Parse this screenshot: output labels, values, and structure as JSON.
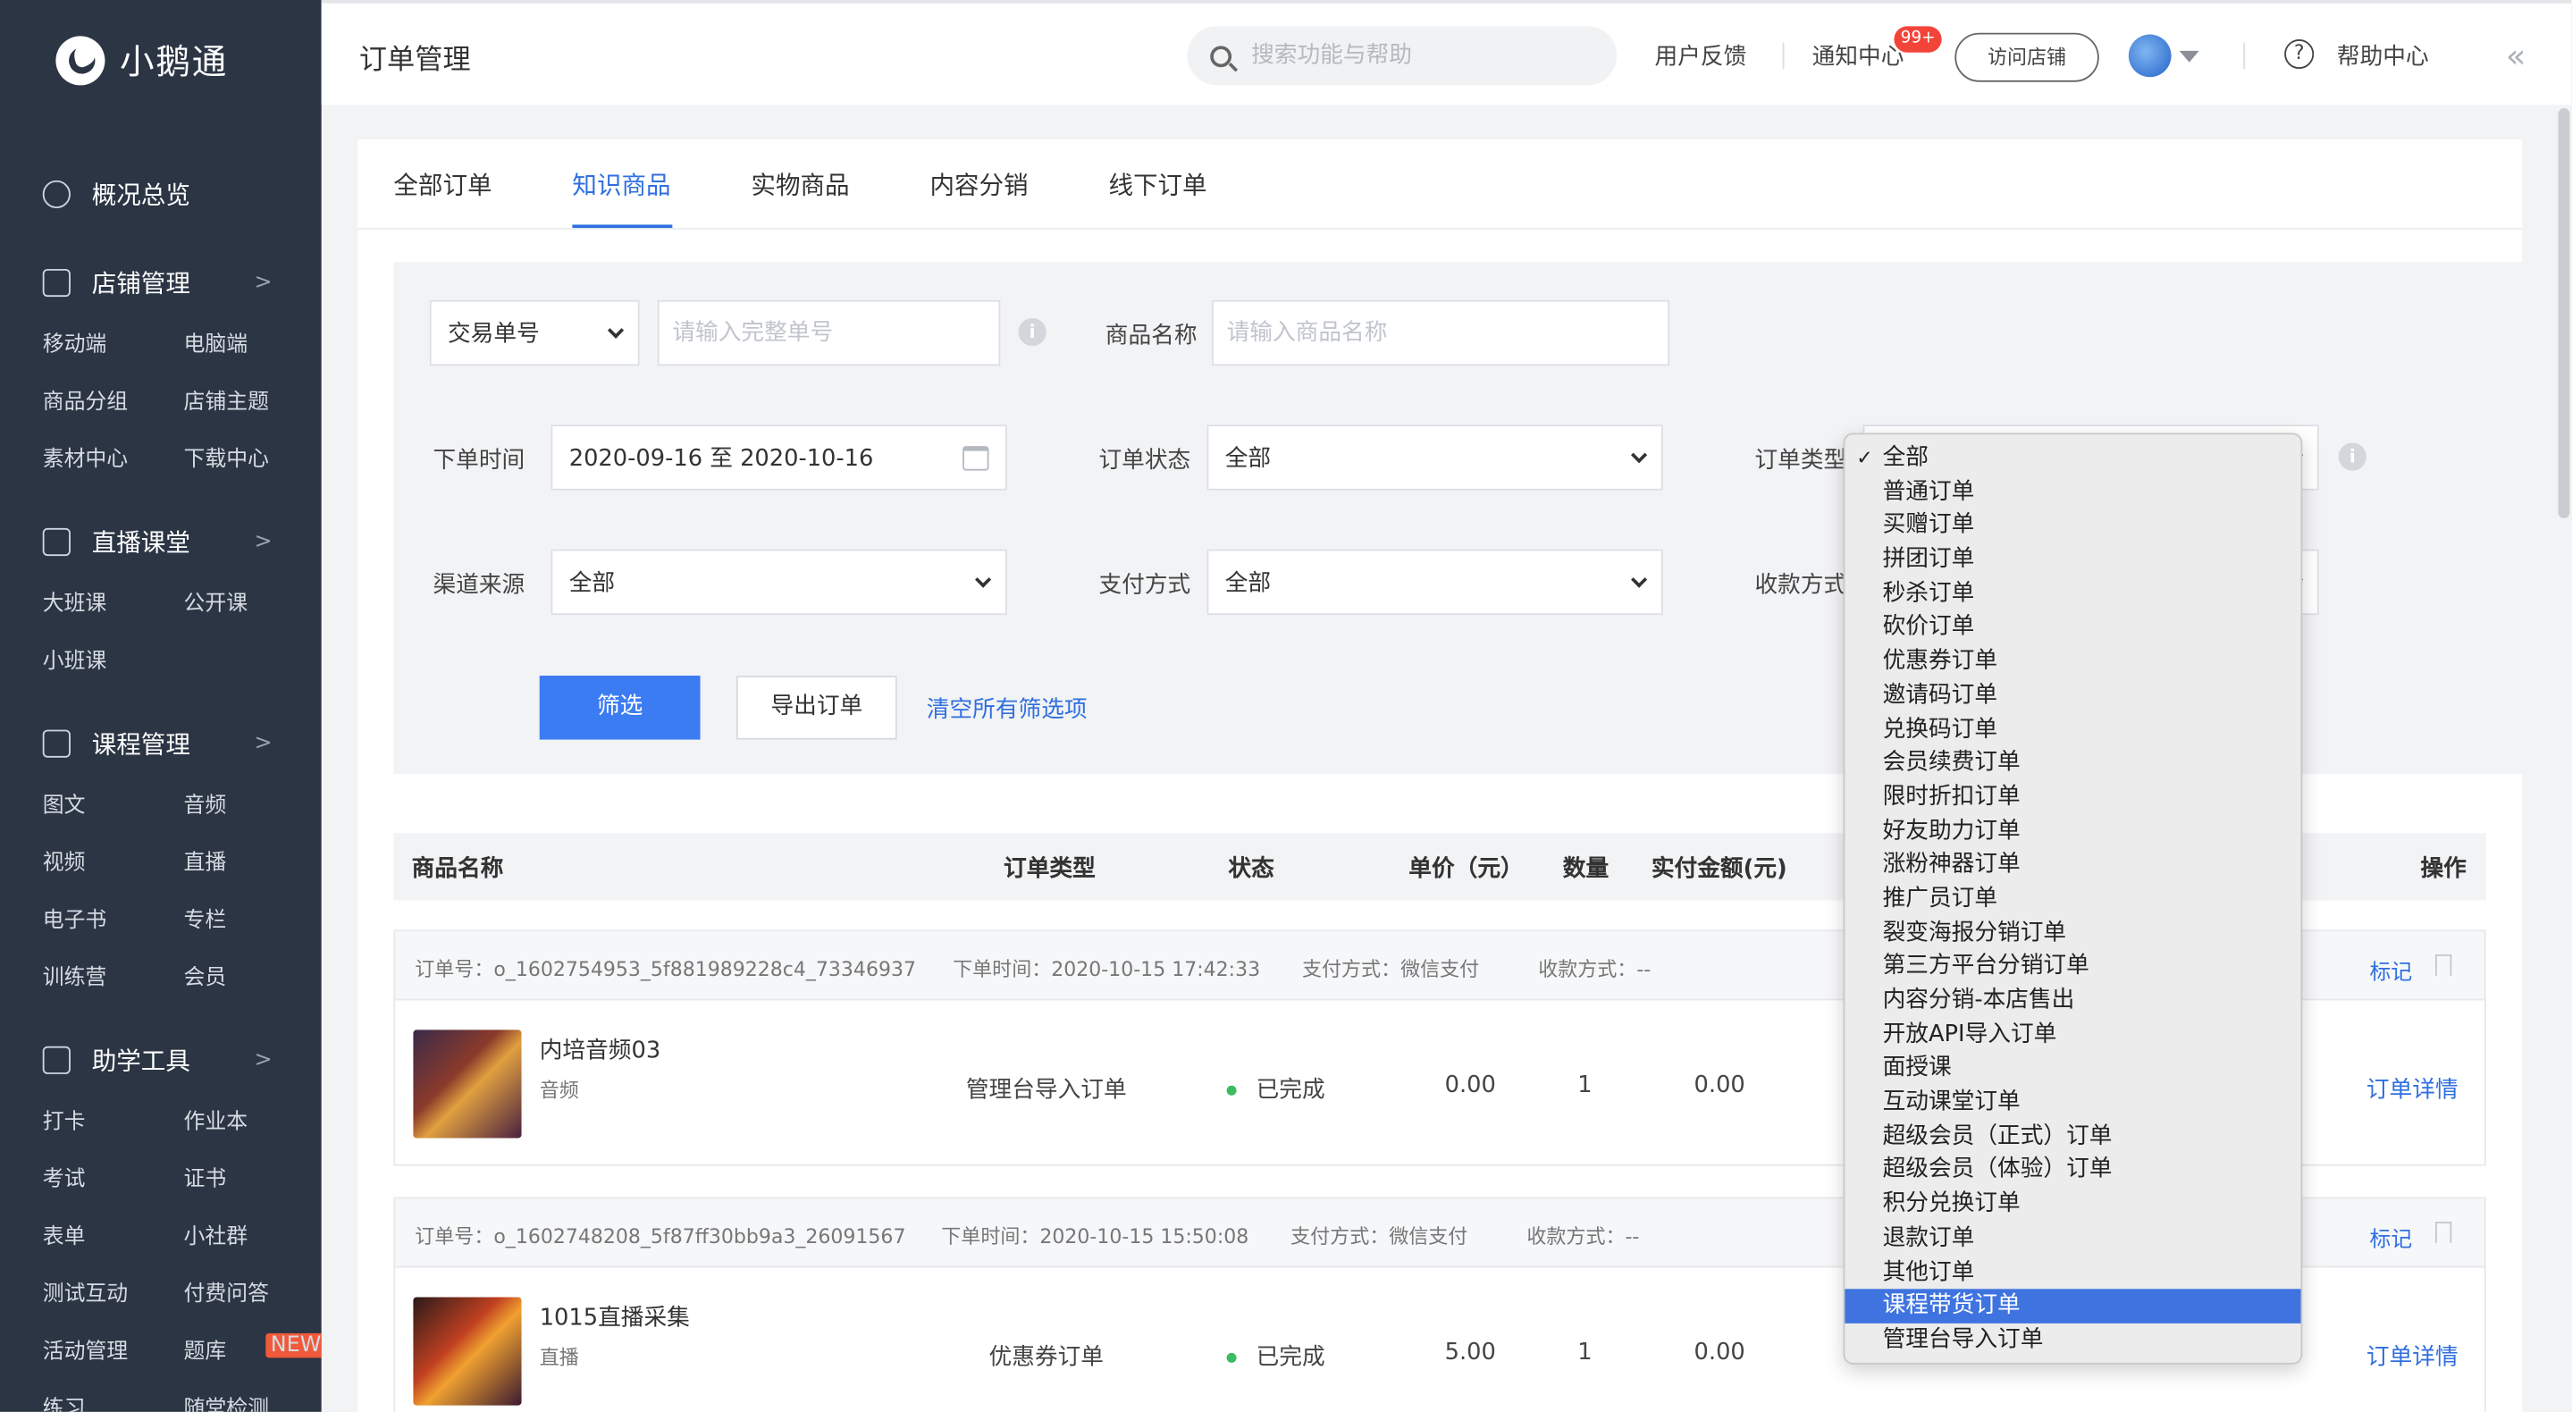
{
  "app": {
    "name": "小鹅通"
  },
  "sidebar": {
    "overview": "概况总览",
    "groups": [
      {
        "title": "店铺管理",
        "items": [
          "移动端",
          "电脑端",
          "商品分组",
          "店铺主题",
          "素材中心",
          "下载中心"
        ]
      },
      {
        "title": "直播课堂",
        "items": [
          "大班课",
          "公开课",
          "小班课"
        ]
      },
      {
        "title": "课程管理",
        "items": [
          "图文",
          "音频",
          "视频",
          "直播",
          "电子书",
          "专栏",
          "训练营",
          "会员"
        ]
      },
      {
        "title": "助学工具",
        "items": [
          "打卡",
          "作业本",
          "考试",
          "证书",
          "表单",
          "小社群",
          "测试互动",
          "付费问答",
          "活动管理",
          "题库",
          "练习",
          "随堂检测"
        ]
      }
    ],
    "new_badge": "NEW"
  },
  "topbar": {
    "page_title": "订单管理",
    "search_placeholder": "搜索功能与帮助",
    "feedback": "用户反馈",
    "notifications": "通知中心",
    "notification_count": "99+",
    "visit_store": "访问店铺",
    "help": "帮助中心"
  },
  "tabs": [
    "全部订单",
    "知识商品",
    "实物商品",
    "内容分销",
    "线下订单"
  ],
  "active_tab": "知识商品",
  "filters": {
    "order_no_select": "交易单号",
    "order_no_placeholder": "请输入完整单号",
    "product_label": "商品名称",
    "product_placeholder": "请输入商品名称",
    "order_time_label": "下单时间",
    "order_time_value": "2020-09-16 至 2020-10-16",
    "order_status_label": "订单状态",
    "order_status_value": "全部",
    "order_type_label": "订单类型",
    "channel_label": "渠道来源",
    "channel_value": "全部",
    "pay_method_label": "支付方式",
    "pay_method_value": "全部",
    "collect_label": "收款方式",
    "filter_button": "筛选",
    "export_button": "导出订单",
    "clear_link": "清空所有筛选项"
  },
  "table": {
    "headers": [
      "商品名称",
      "订单类型",
      "状态",
      "单价（元）",
      "数量",
      "实付金额(元)",
      "操作"
    ],
    "orders": [
      {
        "order_no": "订单号：o_1602754953_5f881989228c4_73346937",
        "order_time": "下单时间：2020-10-15 17:42:33",
        "pay_method": "支付方式：微信支付",
        "collect": "收款方式：--",
        "mark": "标记",
        "product": "内培音频03",
        "product_type": "音频",
        "order_type": "管理台导入订单",
        "status": "已完成",
        "price": "0.00",
        "qty": "1",
        "paid": "0.00",
        "action": "订单详情"
      },
      {
        "order_no": "订单号：o_1602748208_5f87ff30bb9a3_26091567",
        "order_time": "下单时间：2020-10-15 15:50:08",
        "pay_method": "支付方式：微信支付",
        "collect": "收款方式：--",
        "mark": "标记",
        "product": "1015直播采集",
        "product_type": "直播",
        "order_type": "优惠券订单",
        "status": "已完成",
        "price": "5.00",
        "qty": "1",
        "paid": "0.00",
        "action": "订单详情"
      }
    ]
  },
  "order_type_dropdown": {
    "checked": "全部",
    "highlighted": "课程带货订单",
    "options": [
      "全部",
      "普通订单",
      "买赠订单",
      "拼团订单",
      "秒杀订单",
      "砍价订单",
      "优惠券订单",
      "邀请码订单",
      "兑换码订单",
      "会员续费订单",
      "限时折扣订单",
      "好友助力订单",
      "涨粉神器订单",
      "推广员订单",
      "裂变海报分销订单",
      "第三方平台分销订单",
      "内容分销-本店售出",
      "开放API导入订单",
      "面授课",
      "互动课堂订单",
      "超级会员（正式）订单",
      "超级会员（体验）订单",
      "积分兑换订单",
      "退款订单",
      "其他订单",
      "课程带货订单",
      "管理台导入订单"
    ]
  }
}
